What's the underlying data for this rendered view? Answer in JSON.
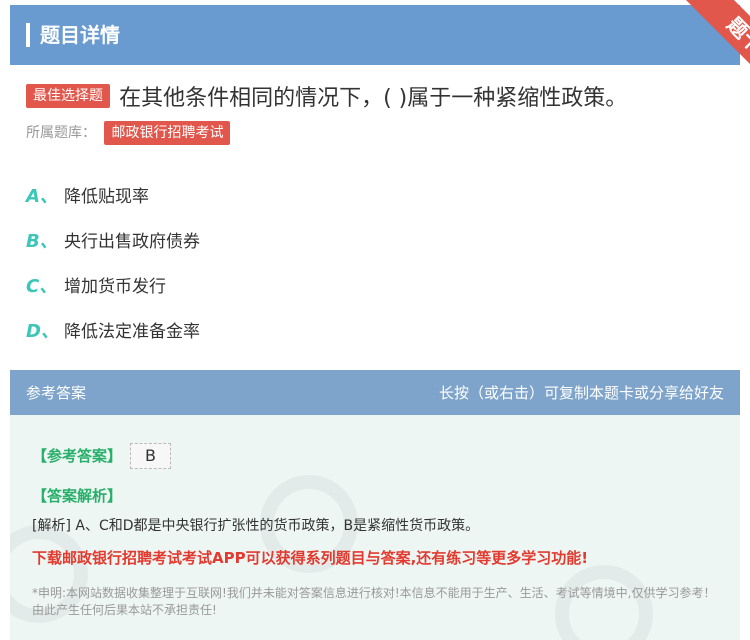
{
  "header": {
    "title": "题目详情",
    "ribbon_label": "题卡"
  },
  "question": {
    "type_tag": "最佳选择题",
    "text": "在其他条件相同的情况下，( )属于一种紧缩性政策。",
    "bank_label": "所属题库：",
    "bank_name": "邮政银行招聘考试"
  },
  "options": [
    {
      "letter": "A、",
      "text": "降低贴现率"
    },
    {
      "letter": "B、",
      "text": "央行出售政府债券"
    },
    {
      "letter": "C、",
      "text": "增加货币发行"
    },
    {
      "letter": "D、",
      "text": "降低法定准备金率"
    }
  ],
  "answer": {
    "header_left": "参考答案",
    "header_right": "长按（或右击）可复制本题卡或分享给好友",
    "answer_label": "【参考答案】",
    "answer_value": "B",
    "analysis_label": "【答案解析】",
    "analysis_text": "[解析] A、C和D都是中央银行扩张性的货币政策，B是紧缩性货币政策。",
    "promo_text": "下载邮政银行招聘考试考试APP可以获得系列题目与答案,还有练习等更多学习功能!",
    "disclaimer": "*申明:本网站数据收集整理于互联网!我们并未能对答案信息进行核对!本信息不能用于生产、生活、考试等情境中,仅供学习参考！由此产生任何后果本站不承担责任!"
  },
  "colors": {
    "header_bg": "#6a9bd0",
    "tag_red": "#e2574c",
    "option_letter": "#3cc6b8",
    "answer_green": "#28b06a",
    "promo_red": "#e23a2e"
  }
}
